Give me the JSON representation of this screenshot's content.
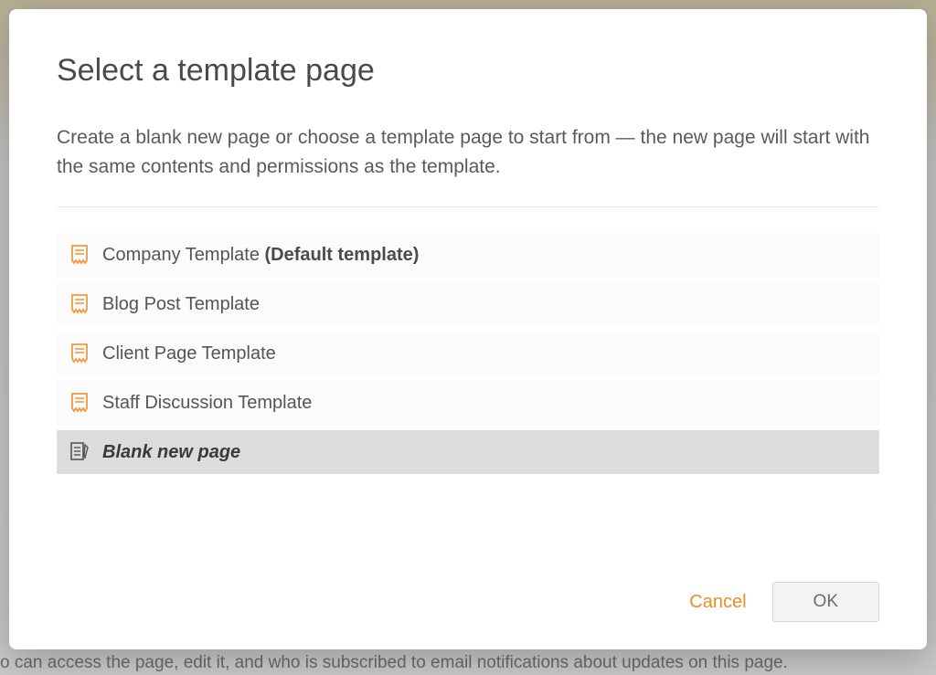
{
  "modal": {
    "title": "Select a template page",
    "description": "Create a blank new page or choose a template page to start from — the new page will start with the same contents and permissions as the template.",
    "templates": [
      {
        "label": "Company Template",
        "suffix": "(Default template)",
        "icon": "template-icon",
        "selected": false
      },
      {
        "label": "Blog Post Template",
        "suffix": "",
        "icon": "template-icon",
        "selected": false
      },
      {
        "label": "Client Page Template",
        "suffix": "",
        "icon": "template-icon",
        "selected": false
      },
      {
        "label": "Staff Discussion Template",
        "suffix": "",
        "icon": "template-icon",
        "selected": false
      },
      {
        "label": "Blank new page",
        "suffix": "",
        "icon": "blank-page-icon",
        "selected": true
      }
    ],
    "actions": {
      "cancel": "Cancel",
      "ok": "OK"
    }
  },
  "backdrop": {
    "bottom_text": "o can access the page, edit it, and who is subscribed to email notifications about updates on this page."
  },
  "colors": {
    "accent": "#f08a24",
    "icon_orange": "#f29a3c"
  }
}
